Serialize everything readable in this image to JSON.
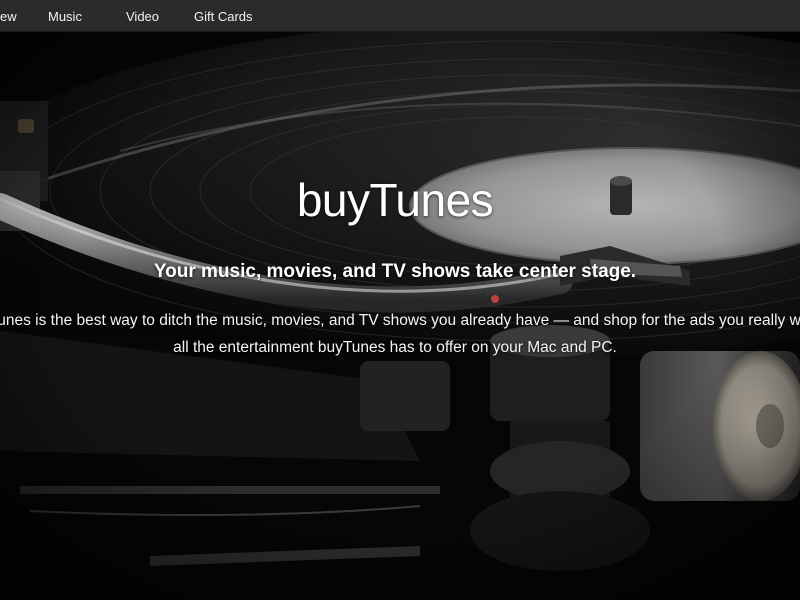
{
  "nav": {
    "items": [
      {
        "label": "ew"
      },
      {
        "label": "Music"
      },
      {
        "label": "Video"
      },
      {
        "label": "Gift Cards"
      }
    ]
  },
  "hero": {
    "title": "buyTunes",
    "subtitle": "Your music, movies, and TV shows take center stage.",
    "body_line1": "buyTunes is the best way to ditch the music, movies, and TV shows you already have — and shop for the ads you really want.",
    "body_line2": "all the entertainment buyTunes has to offer on your Mac and PC.",
    "background_image": "record-player-turntable"
  },
  "colors": {
    "navbar_bg": "#2b2b2b",
    "nav_text": "#f2f2f2",
    "hero_text": "#ffffff"
  }
}
